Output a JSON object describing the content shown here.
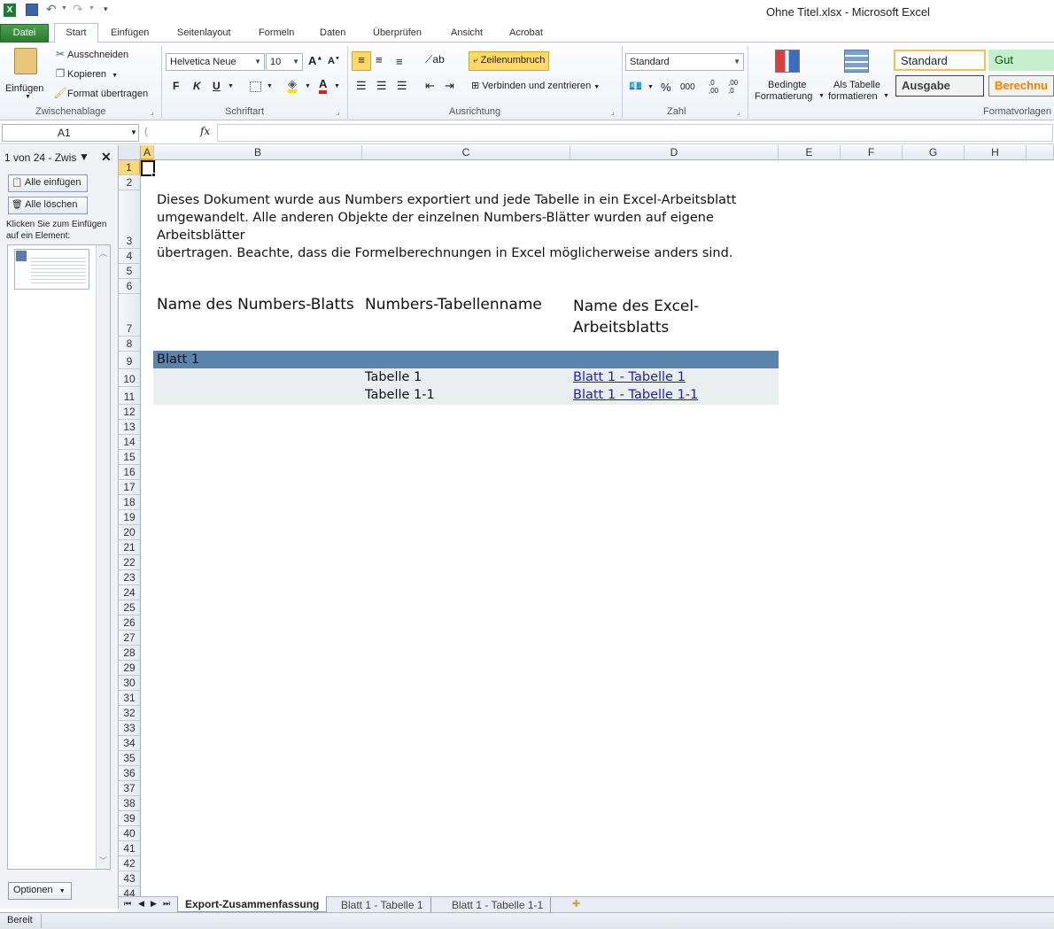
{
  "window": {
    "title": "Ohne Titel.xlsx  -  Microsoft Excel"
  },
  "ribbon": {
    "tabs": [
      "Datei",
      "Start",
      "Einfügen",
      "Seitenlayout",
      "Formeln",
      "Daten",
      "Überprüfen",
      "Ansicht",
      "Acrobat"
    ],
    "clipboard": {
      "paste": "Einfügen",
      "cut": "Ausschneiden",
      "copy": "Kopieren",
      "format_painter": "Format übertragen",
      "group": "Zwischenablage"
    },
    "font": {
      "name": "Helvetica Neue",
      "size": "10",
      "bold": "F",
      "italic": "K",
      "underline": "U",
      "group": "Schriftart"
    },
    "alignment": {
      "wrap": "Zeilenumbruch",
      "merge": "Verbinden und zentrieren",
      "group": "Ausrichtung"
    },
    "number": {
      "format": "Standard",
      "percent": "%",
      "thousands": "000",
      "group": "Zahl"
    },
    "styles": {
      "conditional": [
        "Bedingte",
        "Formatierung"
      ],
      "as_table": [
        "Als Tabelle",
        "formatieren"
      ],
      "standard": "Standard",
      "gut": "Gut",
      "ausgabe": "Ausgabe",
      "berechnung": "Berechnu",
      "group": "Formatvorlagen"
    }
  },
  "formula_bar": {
    "name_box": "A1",
    "fx": "fx",
    "content": ""
  },
  "clipboard_pane": {
    "title": "1 von 24 - Zwis",
    "paste_all": "Alle einfügen",
    "clear_all": "Alle löschen",
    "hint": "Klicken Sie zum Einfügen auf ein Element:",
    "options": "Optionen"
  },
  "columns": [
    "A",
    "B",
    "C",
    "D",
    "E",
    "F",
    "G",
    "H"
  ],
  "rows": [
    "1",
    "2",
    "3",
    "4",
    "5",
    "6",
    "7",
    "8",
    "9",
    "10",
    "11",
    "12",
    "13",
    "14",
    "15",
    "16",
    "17",
    "18",
    "19",
    "20",
    "21",
    "22",
    "23",
    "24",
    "25",
    "26",
    "27",
    "28",
    "29",
    "30",
    "31",
    "32",
    "33",
    "34",
    "35",
    "36",
    "37",
    "38",
    "39",
    "40",
    "41",
    "42",
    "43",
    "44"
  ],
  "sheet": {
    "intro_line1": "Dieses Dokument wurde aus Numbers exportiert und jede Tabelle in ein Excel-Arbeitsblatt",
    "intro_line2": "umgewandelt. Alle anderen Objekte der einzelnen Numbers-Blätter wurden auf eigene Arbeitsblätter",
    "intro_line3": "übertragen. Beachte, dass die Formelberechnungen in Excel möglicherweise anders sind.",
    "header_b": "Name des Numbers-Blatts",
    "header_c": "Numbers-Tabellenname",
    "header_d_line1": "Name des Excel-",
    "header_d_line2": "Arbeitsblatts",
    "band_label": "Blatt 1",
    "table_rows": [
      {
        "table": "Tabelle 1",
        "sheet": "Blatt 1 - Tabelle 1"
      },
      {
        "table": "Tabelle 1-1",
        "sheet": "Blatt 1 - Tabelle 1-1"
      }
    ],
    "colors": {
      "band": "#5b84ac",
      "row_fill": "#ebeeef",
      "link": "#1b1bcc"
    }
  },
  "sheet_tabs": [
    "Export-Zusammenfassung",
    "Blatt 1 - Tabelle 1",
    "Blatt 1 - Tabelle 1-1"
  ],
  "status": {
    "ready": "Bereit"
  }
}
